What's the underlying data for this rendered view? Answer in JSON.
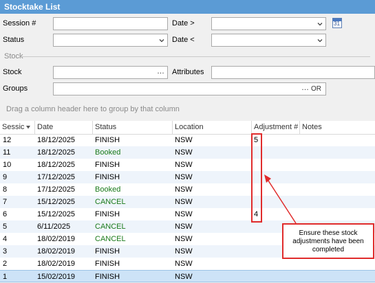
{
  "window": {
    "title": "Stocktake List"
  },
  "filters": {
    "session_label": "Session #",
    "session_value": "",
    "date_from_label": "Date >",
    "date_from_value": "",
    "calendar_day": "31",
    "status_label": "Status",
    "status_value": "",
    "date_to_label": "Date <",
    "date_to_value": "",
    "stock_section_label": "Stock",
    "stock_label": "Stock",
    "stock_value": "",
    "stock_ellipsis": "…",
    "attributes_label": "Attributes",
    "attributes_value": "",
    "groups_label": "Groups",
    "groups_value": "",
    "groups_ellipsis": "…",
    "groups_or": "OR"
  },
  "grid": {
    "group_hint": "Drag a column header here to group by that column",
    "columns": [
      "Sessic",
      "Date",
      "Status",
      "Location",
      "Adjustment #",
      "Notes"
    ],
    "rows": [
      {
        "session": "12",
        "date": "18/12/2025",
        "status": "FINISH",
        "location": "NSW",
        "adjustment": "5",
        "notes": ""
      },
      {
        "session": "11",
        "date": "18/12/2025",
        "status": "Booked",
        "location": "NSW",
        "adjustment": "",
        "notes": ""
      },
      {
        "session": "10",
        "date": "18/12/2025",
        "status": "FINISH",
        "location": "NSW",
        "adjustment": "",
        "notes": ""
      },
      {
        "session": "9",
        "date": "17/12/2025",
        "status": "FINISH",
        "location": "NSW",
        "adjustment": "",
        "notes": ""
      },
      {
        "session": "8",
        "date": "17/12/2025",
        "status": "Booked",
        "location": "NSW",
        "adjustment": "",
        "notes": ""
      },
      {
        "session": "7",
        "date": "15/12/2025",
        "status": "CANCEL",
        "location": "NSW",
        "adjustment": "",
        "notes": ""
      },
      {
        "session": "6",
        "date": "15/12/2025",
        "status": "FINISH",
        "location": "NSW",
        "adjustment": "4",
        "notes": ""
      },
      {
        "session": "5",
        "date": "6/11/2025",
        "status": "CANCEL",
        "location": "NSW",
        "adjustment": "",
        "notes": ""
      },
      {
        "session": "4",
        "date": "18/02/2019",
        "status": "CANCEL",
        "location": "NSW",
        "adjustment": "",
        "notes": ""
      },
      {
        "session": "3",
        "date": "18/02/2019",
        "status": "FINISH",
        "location": "NSW",
        "adjustment": "",
        "notes": ""
      },
      {
        "session": "2",
        "date": "18/02/2019",
        "status": "FINISH",
        "location": "NSW",
        "adjustment": "",
        "notes": ""
      },
      {
        "session": "1",
        "date": "15/02/2019",
        "status": "FINISH",
        "location": "NSW",
        "adjustment": "",
        "notes": ""
      }
    ]
  },
  "annotation": {
    "text": "Ensure these stock adjustments have been completed"
  },
  "colors": {
    "title_bar": "#5b9bd5",
    "status_green": "#1a7a1a",
    "annotation_red": "#e02b2b",
    "selected_row": "#cde3f7"
  }
}
